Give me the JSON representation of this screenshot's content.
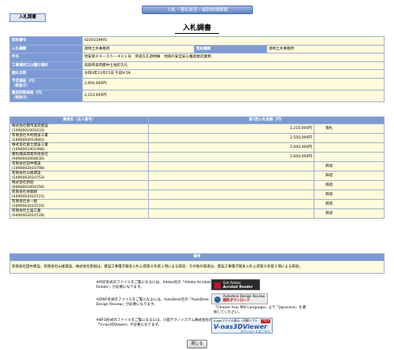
{
  "header": {
    "banner": "入札・落札状況・個別詳細情報",
    "tab": "入札調書",
    "title": "入札調書"
  },
  "info": {
    "contract_no_label": "契約番号",
    "contract_no": "0220319901",
    "order_org_label": "入札機関",
    "order_org": "須崎土木事務所",
    "contract_org_label": "契約機関",
    "contract_org": "須崎土木事務所",
    "project_label": "件名",
    "project": "地安第０９－０５－４０１号　県道久礼須崎線　地域の安全安心推進委託業務",
    "place_label": "工事場所又は履行場所",
    "place": "高知県高岡郡中土佐町久礼",
    "open_label": "開札日時",
    "open": "令和4年11月15日 午前9:59",
    "estimate_label": "予定価格（円）\n（税抜き）",
    "estimate": "2,600,000円",
    "min_label": "最低制限価格（円）\n（税抜き）",
    "min": "2,210,000円"
  },
  "bids": {
    "col_name": "業者名（法人番号）",
    "col_amount": "第1回入札金額（円）",
    "rows": [
      {
        "name": "株式会社都市美装建設",
        "num": "(1490001001633)",
        "amount": "2,210,000円",
        "result": "落札"
      },
      {
        "name": "有限会社木村建設工業",
        "num": "(2490002010681)",
        "amount": "2,550,000円",
        "result": ""
      },
      {
        "name": "株式会社富士建設工業",
        "num": "(1490001001996)",
        "amount": "2,600,000円",
        "result": ""
      },
      {
        "name": "藤松播美開発有限会社",
        "num": "(9490002006635)",
        "amount": "2,600,000円",
        "result": ""
      },
      {
        "name": "有限会社田中建設",
        "num": "(1490002010798)",
        "amount": "",
        "result": "辞退"
      },
      {
        "name": "有限会社山尾建設",
        "num": "(5490002010753)",
        "amount": "",
        "result": "辞退"
      },
      {
        "name": "株式会社新創",
        "num": "(8490001000356)",
        "amount": "",
        "result": "辞退"
      },
      {
        "name": "有限会社谷脇組",
        "num": "(4490002010721)",
        "amount": "",
        "result": "辞退"
      },
      {
        "name": "有限会社谷一組",
        "num": "(3490002010722)",
        "amount": "",
        "result": "辞退"
      },
      {
        "name": "有限会社土居工業",
        "num": "(6490002010728)",
        "amount": "",
        "result": "辞退"
      }
    ]
  },
  "remarks": {
    "heading": "備考",
    "text": "有限会社田中建設、有限会社山尾建設、株式会社新創は、建設工事電子競争入札心得第８条第１項による辞退、その他の辞退は、建設工事電子競争入札心得第８条第３項による辞退。"
  },
  "notes": {
    "pdf": "※PDF形式のファイルをご覧になるには、Adobe社の「Adobe Acrobat Reader」が必要になります。",
    "dwf": "※DWF形式のファイルをご覧になるには、AutoDesk社の「AutoDesk Design Review」が必要になります。",
    "bfo": "※BFO形式のファイルをご覧になるには、川田テクノシステム株式会社の「V-nas3DViewer」が必要になります。",
    "lang": "「Choose Your MSI Language」より「Japanese」を選択してください。"
  },
  "badges": {
    "adobe_top": "Get Adobe",
    "adobe_bottom": "Acrobat Reader",
    "adr_top": "Autodesk Design Review",
    "adr_bottom": "無料ダウンロード",
    "v3d_small": "V-nasファイル表示・印刷ソフト",
    "v3d_big": "V-nas3DViewer",
    "v3d_free": "FREE",
    "v3d_dl": "ダウンロードはこちら"
  },
  "buttons": {
    "close": "閉じる"
  }
}
